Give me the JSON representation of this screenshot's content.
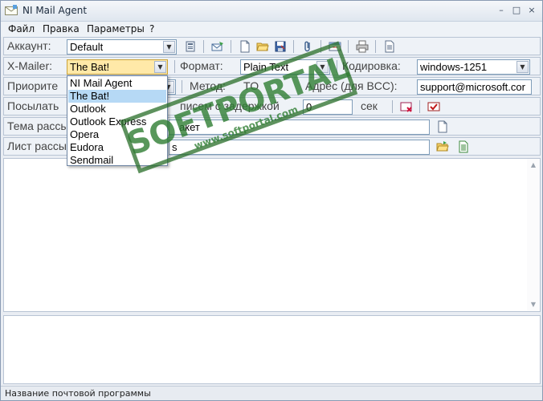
{
  "window": {
    "title": "NI Mail Agent"
  },
  "window_buttons": [
    "–",
    "□",
    "×"
  ],
  "menu": [
    "Файл",
    "Правка",
    "Параметры",
    "?"
  ],
  "account": {
    "label": "Аккаунт:",
    "value": "Default"
  },
  "xmailer": {
    "label": "X-Mailer:",
    "value": "The Bat!",
    "format_label": "Формат:",
    "format_value": "Plain Text",
    "encoding_label": "Кодировка:",
    "encoding_value": "windows-1251"
  },
  "priority": {
    "label": "Приорите",
    "method_label": "Метод:",
    "method_value": "TO",
    "bcc_label": "Адрес (для BCC):",
    "bcc_value": "support@microsoft.cor"
  },
  "send": {
    "label": "Посылать",
    "delay_label": "писем с задержкой",
    "delay_value": "0",
    "unit": "сек"
  },
  "subject": {
    "label": "Тема рассы",
    "value": "акет"
  },
  "list": {
    "label": "Лист рассы",
    "value": "s"
  },
  "dropdown_items": [
    "NI Mail Agent",
    "The Bat!",
    "Outlook",
    "Outlook Express",
    "Opera",
    "Eudora",
    "Sendmail"
  ],
  "dropdown_selected": "The Bat!",
  "watermark": {
    "brand": "SOFTPORTAL",
    "url": "www.softportal.com"
  },
  "status": "Название почтовой программы",
  "colors": {
    "selection": "#b6d9f5",
    "active_combo": "#ffe9a8",
    "watermark": "#2e7d32"
  }
}
